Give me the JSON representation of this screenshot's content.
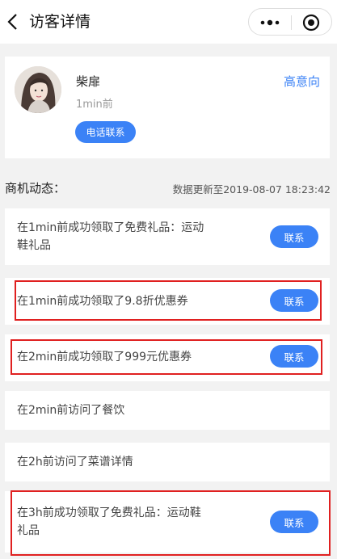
{
  "header": {
    "title": "访客详情",
    "back_icon": "chevron-left-icon",
    "more_icon": "more-dots-icon",
    "target_icon": "target-icon"
  },
  "profile": {
    "name": "柴扉",
    "time": "1min前",
    "intent": "高意向",
    "phone_button": "电话联系"
  },
  "section": {
    "title": "商机动态：",
    "update_note": "数据更新至2019-08-07 18:23:42"
  },
  "activities": [
    {
      "text_line1": "在1min前成功领取了免费礼品：运动",
      "text_line2": "鞋礼品",
      "button": "联系"
    },
    {
      "text_line1": "在1min前成功领取了9.8折优惠券",
      "button": "联系"
    },
    {
      "text_line1": "在2min前成功领取了999元优惠券",
      "button": "联系"
    },
    {
      "text_line1": "在2min前访问了餐饮"
    },
    {
      "text_line1": "在2h前访问了菜谱详情"
    },
    {
      "text_line1": "在3h前成功领取了免费礼品：运动鞋",
      "text_line2": "礼品",
      "button": "联系"
    }
  ],
  "colors": {
    "accent": "#3b82f6",
    "highlight": "#e02020",
    "background": "#f2f2f2"
  }
}
